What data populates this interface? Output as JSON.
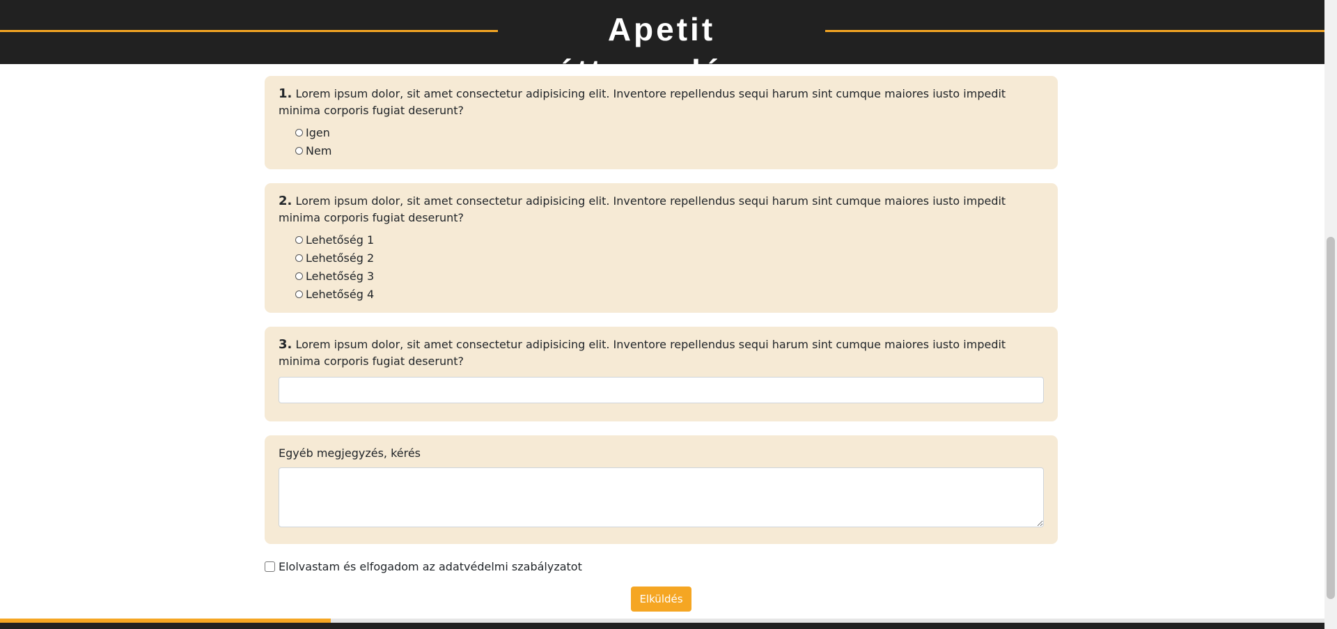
{
  "header": {
    "title": "Apetit étteremlánc",
    "accent_color": "#f5a623",
    "background_color": "#212121"
  },
  "questions": [
    {
      "number": "1.",
      "text": "Lorem ipsum dolor, sit amet consectetur adipisicing elit. Inventore repellendus sequi harum sint cumque maiores iusto impedit minima corporis fugiat deserunt?",
      "type": "radio",
      "options": [
        "Igen",
        "Nem"
      ]
    },
    {
      "number": "2.",
      "text": "Lorem ipsum dolor, sit amet consectetur adipisicing elit. Inventore repellendus sequi harum sint cumque maiores iusto impedit minima corporis fugiat deserunt?",
      "type": "radio",
      "options": [
        "Lehetőség 1",
        "Lehetőség 2",
        "Lehetőség 3",
        "Lehetőség 4"
      ]
    },
    {
      "number": "3.",
      "text": "Lorem ipsum dolor, sit amet consectetur adipisicing elit. Inventore repellendus sequi harum sint cumque maiores iusto impedit minima corporis fugiat deserunt?",
      "type": "text",
      "value": ""
    }
  ],
  "comments": {
    "label": "Egyéb megjegyzés, kérés",
    "value": ""
  },
  "consent": {
    "label": "Elolvastam és elfogadom az adatvédelmi szabályzatot",
    "checked": false
  },
  "submit": {
    "label": "Elküldés"
  },
  "card_color": "#f6ead5"
}
